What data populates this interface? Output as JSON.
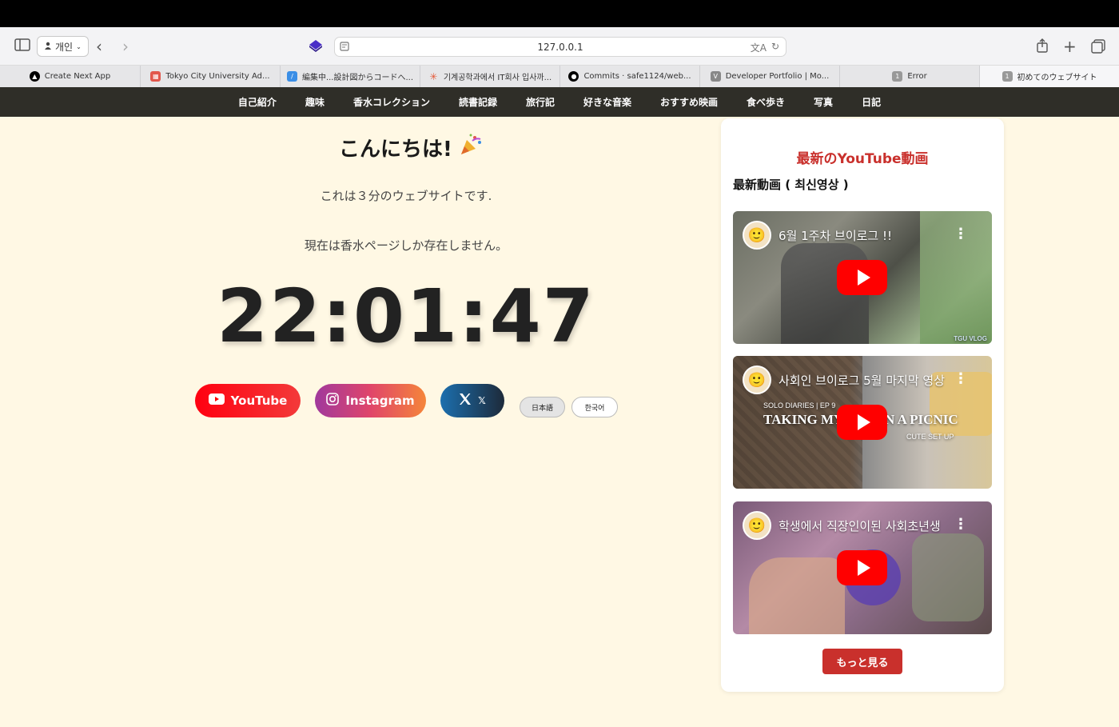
{
  "browser": {
    "profile_label": "개인",
    "address": "127.0.0.1",
    "tabs": [
      {
        "label": "Create Next App"
      },
      {
        "label": "Tokyo City University Ad..."
      },
      {
        "label": "編集中...設計図からコードへ..."
      },
      {
        "label": "기계공학과에서 IT회사 입사까..."
      },
      {
        "label": "Commits · safe1124/web..."
      },
      {
        "label": "Developer Portfolio | Mo..."
      },
      {
        "label": "Error",
        "badge": "1"
      },
      {
        "label": "初めてのウェブサイト",
        "badge": "1"
      }
    ]
  },
  "nav": {
    "items": [
      "自己紹介",
      "趣味",
      "香水コレクション",
      "読書記録",
      "旅行記",
      "好きな音楽",
      "おすすめ映画",
      "食べ歩き",
      "写真",
      "日記"
    ]
  },
  "main": {
    "greeting": "こんにちは!",
    "line1": "これは３分のウェブサイトです.",
    "line2": "現在は香水ページしか存在しません。",
    "clock": "22:01:47",
    "social": {
      "youtube": "YouTube",
      "instagram": "Instagram",
      "x": "𝕏"
    },
    "lang": {
      "ja": "日本語",
      "ko": "한국어"
    }
  },
  "sidebar": {
    "title": "最新のYouTube動画",
    "subtitle": "最新動画 ( 최신영상 )",
    "videos": [
      {
        "title": "6월 1주차 브이로그 !!",
        "overlay": "TGU VLOG"
      },
      {
        "title": "사회인 브이로그 5월 마지막 영상",
        "overlay_top": "SOLO DIARIES | EP 9",
        "overlay_main": "TAKING MY",
        "overlay_right": "N A PICNIC",
        "overlay_sub": "CUTE SET UP"
      },
      {
        "title": "학생에서 직장인이된 사회초년생"
      }
    ],
    "more": "もっと見る"
  },
  "colors": {
    "page_bg": "#fff8e4",
    "nav_bg": "#2f2e28",
    "accent_red": "#c9302c",
    "youtube_red": "#ff0000"
  }
}
